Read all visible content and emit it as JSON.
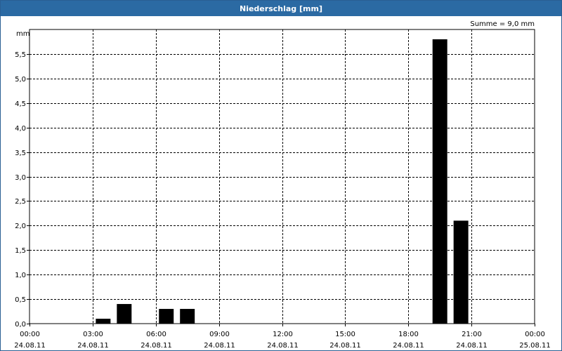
{
  "window": {
    "title": "Niederschlag [mm]"
  },
  "summary": {
    "text": "Summe = 9,0 mm"
  },
  "colors": {
    "titlebar": "#2b6aa3",
    "bar": "#000000",
    "grid": "#000000"
  },
  "chart_data": {
    "type": "bar",
    "title": "Niederschlag [mm]",
    "ylabel": "mm",
    "ylim": [
      0,
      6.0
    ],
    "yticks": [
      {
        "v": 0.0,
        "label": "0,0"
      },
      {
        "v": 0.5,
        "label": "0,5"
      },
      {
        "v": 1.0,
        "label": "1,0"
      },
      {
        "v": 1.5,
        "label": "1,5"
      },
      {
        "v": 2.0,
        "label": "2,0"
      },
      {
        "v": 2.5,
        "label": "2,5"
      },
      {
        "v": 3.0,
        "label": "3,0"
      },
      {
        "v": 3.5,
        "label": "3,5"
      },
      {
        "v": 4.0,
        "label": "4,0"
      },
      {
        "v": 4.5,
        "label": "4,5"
      },
      {
        "v": 5.0,
        "label": "5,0"
      },
      {
        "v": 5.5,
        "label": "5,5"
      }
    ],
    "xlim_hours": [
      0,
      24
    ],
    "xticks": [
      {
        "h": 0,
        "time": "00:00",
        "date": "24.08.11"
      },
      {
        "h": 3,
        "time": "03:00",
        "date": "24.08.11"
      },
      {
        "h": 6,
        "time": "06:00",
        "date": "24.08.11"
      },
      {
        "h": 9,
        "time": "09:00",
        "date": "24.08.11"
      },
      {
        "h": 12,
        "time": "12:00",
        "date": "24.08.11"
      },
      {
        "h": 15,
        "time": "15:00",
        "date": "24.08.11"
      },
      {
        "h": 18,
        "time": "18:00",
        "date": "24.08.11"
      },
      {
        "h": 21,
        "time": "21:00",
        "date": "24.08.11"
      },
      {
        "h": 24,
        "time": "00:00",
        "date": "25.08.11"
      }
    ],
    "bars": [
      {
        "start": "03:00",
        "end": "04:00",
        "value": 0.1
      },
      {
        "start": "04:00",
        "end": "05:00",
        "value": 0.4
      },
      {
        "start": "06:00",
        "end": "07:00",
        "value": 0.3
      },
      {
        "start": "07:00",
        "end": "08:00",
        "value": 0.3
      },
      {
        "start": "19:00",
        "end": "20:00",
        "value": 5.8
      },
      {
        "start": "20:00",
        "end": "21:00",
        "value": 2.1
      }
    ],
    "grid": true
  }
}
